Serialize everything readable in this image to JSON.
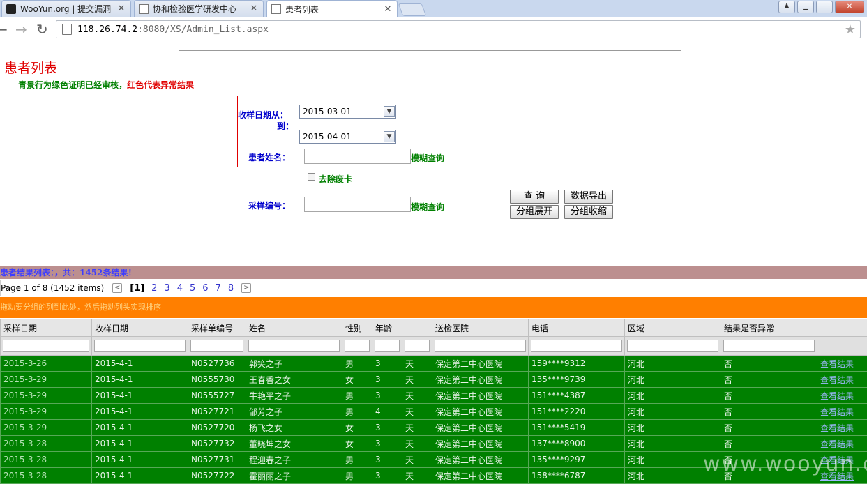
{
  "browser": {
    "tabs": [
      {
        "title": "WooYun.org | 提交漏洞"
      },
      {
        "title": "协和检验医学研发中心"
      },
      {
        "title": "患者列表"
      }
    ],
    "url_host": "118.26.74.2",
    "url_rest": ":8080/XS/Admin_List.aspx"
  },
  "page": {
    "title": "患者列表",
    "hint_green": "青景行为绿色证明已经审核，",
    "hint_red": "红色代表异常结果"
  },
  "filters": {
    "date_from_label": "收样日期从：",
    "date_to_label": "到：",
    "date_from": "2015-03-01",
    "date_to": "2015-04-01",
    "patient_name_label": "患者姓名：",
    "fuzzy1": "模糊查询",
    "remove_void_label": "去除废卡",
    "sample_no_label": "采样编号：",
    "fuzzy2": "模糊查询",
    "btn_query": "查 询",
    "btn_export": "数据导出",
    "btn_expand": "分组展开",
    "btn_collapse": "分组收缩"
  },
  "grid": {
    "summary": "患者结果列表：，共：1452条结果！",
    "pager": {
      "info": "Page 1 of 8 (1452 items)",
      "current": "[1]",
      "pages": [
        "2",
        "3",
        "4",
        "5",
        "6",
        "7",
        "8"
      ],
      "prev_arrow": "<",
      "next_arrow": ">"
    },
    "group_hint": "拖动要分组的列到此处，然后拖动列头实现排序",
    "headers": [
      "采样日期",
      "收样日期",
      "采样单编号",
      "姓名",
      "性别",
      "年龄",
      "",
      "送检医院",
      "电话",
      "区域",
      "结果是否异常",
      ""
    ],
    "rows": [
      [
        "2015-3-26",
        "2015-4-1",
        "N0527736",
        "郭笑之子",
        "男",
        "3",
        "天",
        "保定第二中心医院",
        "159****9312",
        "河北",
        "否",
        "查看结果"
      ],
      [
        "2015-3-29",
        "2015-4-1",
        "N0555730",
        "王春香之女",
        "女",
        "3",
        "天",
        "保定第二中心医院",
        "135****9739",
        "河北",
        "否",
        "查看结果"
      ],
      [
        "2015-3-29",
        "2015-4-1",
        "N0555727",
        "牛艳平之子",
        "男",
        "3",
        "天",
        "保定第二中心医院",
        "151****4387",
        "河北",
        "否",
        "查看结果"
      ],
      [
        "2015-3-29",
        "2015-4-1",
        "N0527721",
        "邹芳之子",
        "男",
        "4",
        "天",
        "保定第二中心医院",
        "151****2220",
        "河北",
        "否",
        "查看结果"
      ],
      [
        "2015-3-29",
        "2015-4-1",
        "N0527720",
        "杨飞之女",
        "女",
        "3",
        "天",
        "保定第二中心医院",
        "151****5419",
        "河北",
        "否",
        "查看结果"
      ],
      [
        "2015-3-28",
        "2015-4-1",
        "N0527732",
        "董晓坤之女",
        "女",
        "3",
        "天",
        "保定第二中心医院",
        "137****8900",
        "河北",
        "否",
        "查看结果"
      ],
      [
        "2015-3-28",
        "2015-4-1",
        "N0527731",
        "程迎春之子",
        "男",
        "3",
        "天",
        "保定第二中心医院",
        "135****9297",
        "河北",
        "否",
        "查看结果"
      ],
      [
        "2015-3-28",
        "2015-4-1",
        "N0527722",
        "霍丽丽之子",
        "男",
        "3",
        "天",
        "保定第二中心医院",
        "158****6787",
        "河北",
        "否",
        "查看结果"
      ]
    ]
  },
  "watermark": "www.wooyun.org"
}
